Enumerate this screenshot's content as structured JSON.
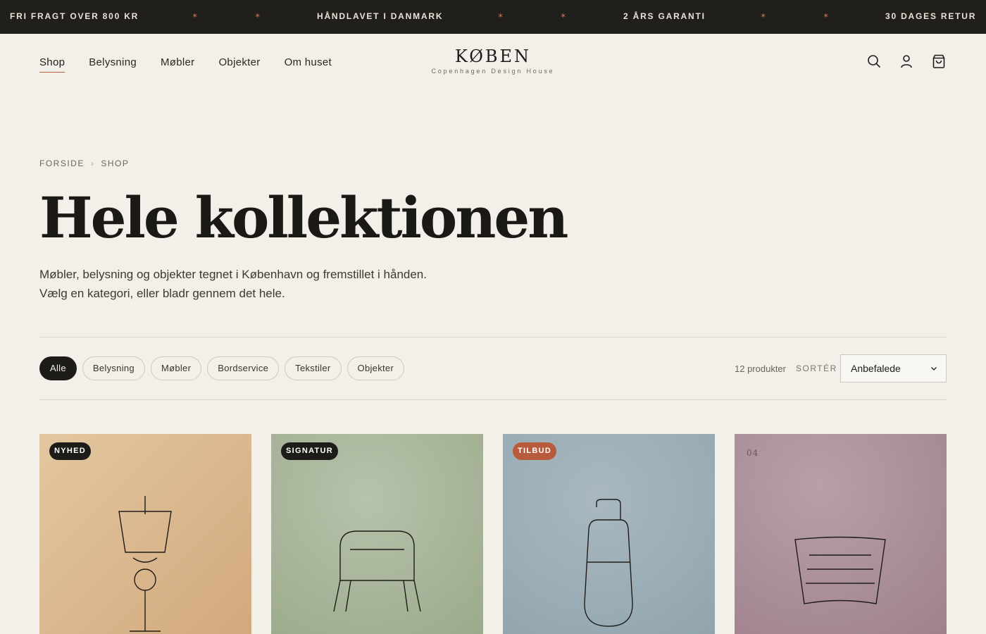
{
  "announcement": {
    "items": [
      "FRI FRAGT OVER 800 KR",
      "HÅNDLAVET I DANMARK",
      "2 ÅRS GARANTI",
      "30 DAGES RETUR"
    ],
    "separator": "✶"
  },
  "nav": {
    "items": [
      {
        "label": "Shop",
        "active": true
      },
      {
        "label": "Belysning",
        "active": false
      },
      {
        "label": "Møbler",
        "active": false
      },
      {
        "label": "Objekter",
        "active": false
      },
      {
        "label": "Om huset",
        "active": false
      }
    ]
  },
  "brand": {
    "name": "KØBEN",
    "tagline": "Copenhagen Design House"
  },
  "header_icons": [
    "search-icon",
    "account-icon",
    "cart-icon"
  ],
  "breadcrumb": {
    "home": "FORSIDE",
    "current": "SHOP"
  },
  "page": {
    "title": "Hele kollektionen",
    "description": "Møbler, belysning og objekter tegnet i København og fremstillet i hånden. Vælg en kategori, eller bladr gennem det hele."
  },
  "filters": {
    "chips": [
      {
        "label": "Alle",
        "selected": true
      },
      {
        "label": "Belysning",
        "selected": false
      },
      {
        "label": "Møbler",
        "selected": false
      },
      {
        "label": "Bordservice",
        "selected": false
      },
      {
        "label": "Tekstiler",
        "selected": false
      },
      {
        "label": "Objekter",
        "selected": false
      }
    ],
    "count": "12 produkter",
    "sort_label": "SORTÉR",
    "sort_value": "Anbefalede"
  },
  "products": [
    {
      "badge": "NYHED",
      "badge_color": "#1e1c19",
      "illustration": "pendant-lamp"
    },
    {
      "badge": "SIGNATUR",
      "badge_color": "#1e1c19",
      "illustration": "chair"
    },
    {
      "badge": "TILBUD",
      "badge_color": "#b85a3c",
      "illustration": "bottle-vase"
    },
    {
      "number": "04",
      "illustration": "basket"
    }
  ],
  "colors": {
    "accent": "#b85a3c",
    "dark": "#211f1b",
    "background": "#f3f0ea"
  }
}
